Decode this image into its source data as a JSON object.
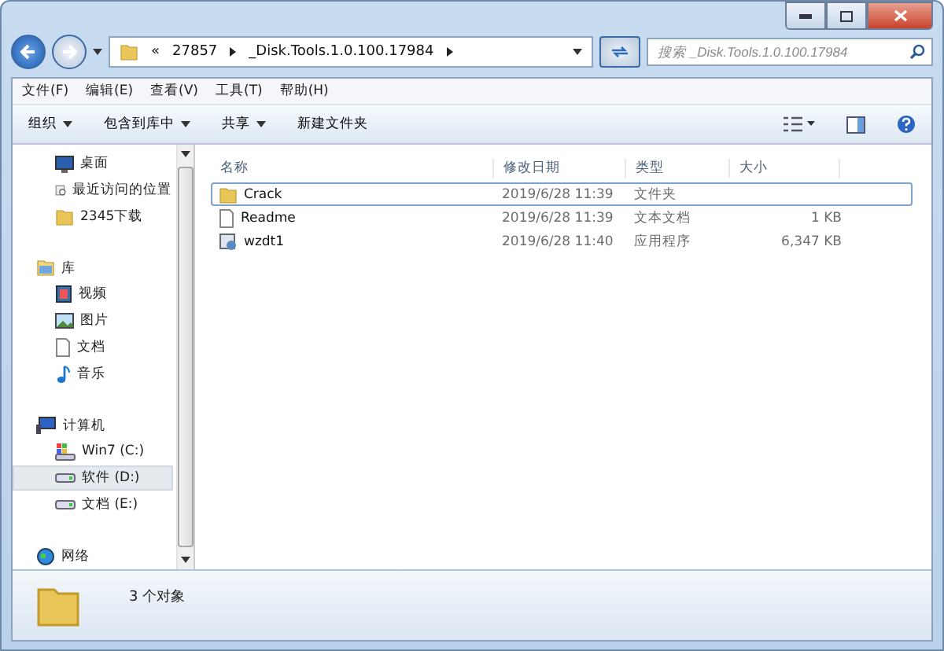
{
  "address": {
    "crumbs": [
      "«",
      "27857",
      "_Disk.Tools.1.0.100.17984"
    ]
  },
  "search": {
    "placeholder": "搜索 _Disk.Tools.1.0.100.17984"
  },
  "menu": [
    "文件(F)",
    "编辑(E)",
    "查看(V)",
    "工具(T)",
    "帮助(H)"
  ],
  "toolbar": [
    {
      "label": "组织",
      "dropdown": true
    },
    {
      "label": "包含到库中",
      "dropdown": true
    },
    {
      "label": "共享",
      "dropdown": true
    },
    {
      "label": "新建文件夹",
      "dropdown": false
    }
  ],
  "sidebar": {
    "groups": [
      {
        "items": [
          {
            "label": "桌面",
            "kind": "desktop",
            "selected": false
          },
          {
            "label": "最近访问的位置",
            "kind": "recent",
            "selected": false
          },
          {
            "label": "2345下载",
            "kind": "folder",
            "selected": false
          }
        ]
      },
      {
        "header": {
          "label": "库",
          "kind": "library"
        },
        "items": [
          {
            "label": "视频",
            "kind": "video",
            "selected": false
          },
          {
            "label": "图片",
            "kind": "picture",
            "selected": false
          },
          {
            "label": "文档",
            "kind": "doc",
            "selected": false
          },
          {
            "label": "音乐",
            "kind": "music",
            "selected": false
          }
        ]
      },
      {
        "header": {
          "label": "计算机",
          "kind": "computer"
        },
        "items": [
          {
            "label": "Win7 (C:)",
            "kind": "windrive",
            "selected": false
          },
          {
            "label": "软件 (D:)",
            "kind": "drive",
            "selected": true
          },
          {
            "label": "文档 (E:)",
            "kind": "drive",
            "selected": false
          }
        ]
      },
      {
        "header": {
          "label": "网络",
          "kind": "network"
        }
      }
    ]
  },
  "table": {
    "columns": [
      "名称",
      "修改日期",
      "类型",
      "大小"
    ],
    "rows": [
      {
        "name": "Crack",
        "kind": "folder",
        "date": "2019/6/28 11:39",
        "type": "文件夹",
        "selected": true
      },
      {
        "name": "Readme",
        "kind": "text",
        "date": "2019/6/28 11:39",
        "type": "文本文档",
        "size": "1 KB",
        "selected": false
      },
      {
        "name": "wzdt1",
        "kind": "app",
        "date": "2019/6/28 11:40",
        "type": "应用程序",
        "size": "6,347 KB",
        "selected": false
      }
    ]
  },
  "status_bar": {
    "count": "3 个对象"
  }
}
